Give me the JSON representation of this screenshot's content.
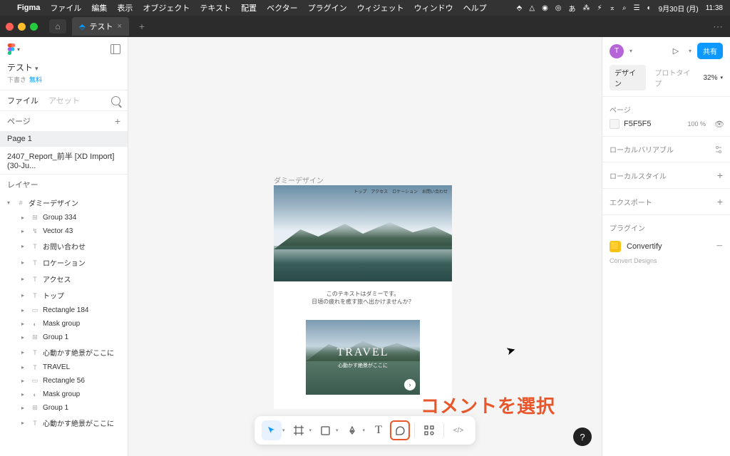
{
  "menubar": {
    "app": "Figma",
    "items": [
      "ファイル",
      "編集",
      "表示",
      "オブジェクト",
      "テキスト",
      "配置",
      "ベクター",
      "プラグイン",
      "ウィジェット",
      "ウィンドウ",
      "ヘルプ"
    ],
    "date": "9月30日 (月)",
    "time": "11:38"
  },
  "tabs": {
    "current": "テスト"
  },
  "left": {
    "file_title": "テスト",
    "status": "下書き",
    "free": "無料",
    "tab_file": "ファイル",
    "tab_asset": "アセット",
    "section_pages": "ページ",
    "pages": [
      "Page 1",
      "2407_Report_前半  [XD Import] (30-Ju..."
    ],
    "section_layers": "レイヤー",
    "frame": "ダミーデザイン",
    "layers": [
      {
        "t": "group",
        "n": "Group 334"
      },
      {
        "t": "vector",
        "n": "Vector 43"
      },
      {
        "t": "text",
        "n": "お問い合わせ"
      },
      {
        "t": "text",
        "n": "ロケーション"
      },
      {
        "t": "text",
        "n": "アクセス"
      },
      {
        "t": "text",
        "n": "トップ"
      },
      {
        "t": "rect",
        "n": "Rectangle 184"
      },
      {
        "t": "mask",
        "n": "Mask group"
      },
      {
        "t": "group",
        "n": "Group 1"
      },
      {
        "t": "text",
        "n": "心動かす絶景がここに"
      },
      {
        "t": "text",
        "n": "TRAVEL"
      },
      {
        "t": "rect",
        "n": "Rectangle 56"
      },
      {
        "t": "mask",
        "n": "Mask group"
      },
      {
        "t": "group",
        "n": "Group 1"
      },
      {
        "t": "text",
        "n": "心動かす絶景がここに"
      }
    ]
  },
  "canvas": {
    "frame_label": "ダミーデザイン",
    "nav": [
      "トップ",
      "アクセス",
      "ロケーション",
      "お問い合わせ"
    ],
    "intro1": "このテキストはダミーです。",
    "intro2": "日頃の疲れを癒す旅へ出かけませんか？",
    "card_title": "TRAVEL",
    "card_sub": "心動かす絶景がここに",
    "annotation": "コメントを選択"
  },
  "toolbar": {
    "tools": [
      {
        "n": "move",
        "glyph": "▲",
        "active": true,
        "chev": true
      },
      {
        "n": "frame",
        "glyph": "#",
        "chev": true
      },
      {
        "n": "shape",
        "glyph": "□",
        "chev": true
      },
      {
        "n": "pen",
        "glyph": "✎",
        "chev": true
      },
      {
        "n": "text",
        "glyph": "T"
      },
      {
        "n": "comment",
        "glyph": "◯",
        "highlight": true
      },
      {
        "n": "plugins",
        "glyph": "⊞"
      },
      {
        "n": "devmode",
        "glyph": "</>"
      }
    ]
  },
  "right": {
    "avatar": "T",
    "share": "共有",
    "tab_design": "デザイン",
    "tab_proto": "プロトタイプ",
    "zoom": "32%",
    "section_page": "ページ",
    "bg_hex": "F5F5F5",
    "bg_opacity": "100",
    "bg_unit": "%",
    "section_vars": "ローカルバリアブル",
    "section_styles": "ローカルスタイル",
    "section_export": "エクスポート",
    "section_plugin": "プラグイン",
    "plugin_name": "Convertify",
    "plugin_sub": "Convert Designs"
  }
}
